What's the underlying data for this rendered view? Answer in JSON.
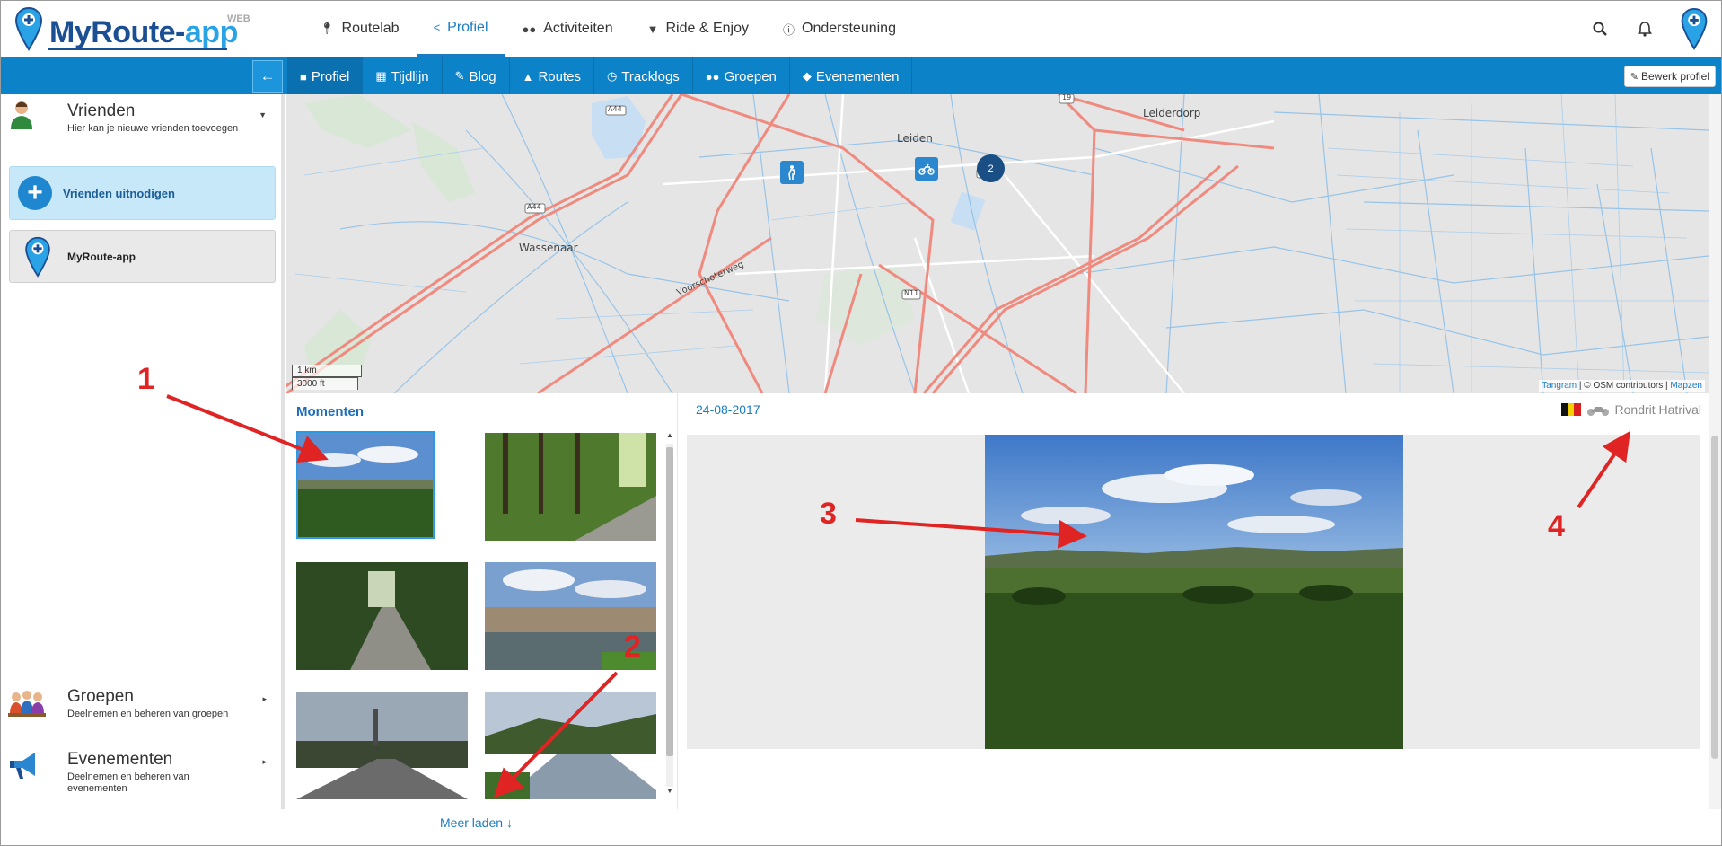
{
  "header": {
    "logo_prefix": "MyRoute-",
    "logo_suffix": "app",
    "logo_tag": "WEB",
    "nav": [
      {
        "label": "Routelab",
        "icon": "map-marker-icon"
      },
      {
        "label": "Profiel",
        "icon": "share-icon",
        "active": true
      },
      {
        "label": "Activiteiten",
        "icon": "users-icon"
      },
      {
        "label": "Ride & Enjoy",
        "icon": "trophy-icon"
      },
      {
        "label": "Ondersteuning",
        "icon": "info-icon"
      }
    ]
  },
  "subnav": {
    "tabs": [
      {
        "label": "Profiel",
        "icon": "user-icon",
        "active": true
      },
      {
        "label": "Tijdlijn",
        "icon": "calendar-icon"
      },
      {
        "label": "Blog",
        "icon": "pencil-icon"
      },
      {
        "label": "Routes",
        "icon": "road-icon"
      },
      {
        "label": "Tracklogs",
        "icon": "clock-icon"
      },
      {
        "label": "Groepen",
        "icon": "users-icon"
      },
      {
        "label": "Evenementen",
        "icon": "ticket-icon"
      }
    ],
    "edit_label": "Bewerk profiel"
  },
  "sidebar": {
    "friends": {
      "title": "Vrienden",
      "subtitle": "Hier kan je nieuwe vrienden toevoegen",
      "invite_label": "Vrienden uitnodigen",
      "contact_name": "MyRoute-app"
    },
    "groups": {
      "title": "Groepen",
      "subtitle": "Deelnemen en beheren van groepen"
    },
    "events": {
      "title": "Evenementen",
      "subtitle": "Deelnemen en beheren van evenementen"
    }
  },
  "map": {
    "labels": {
      "leiden": "Leiden",
      "leiderdorp": "Leiderdorp",
      "wassenaar": "Wassenaar",
      "voorschoterweg": "Voorschoterweg",
      "a44_top": "A44",
      "a44_mid": "A44",
      "n19_top": "19",
      "n19_mid": "19",
      "n11": "N11"
    },
    "cluster_count": "2",
    "scale_km": "1 km",
    "scale_ft": "3000 ft",
    "attribution": {
      "tangram": "Tangram",
      "osm": "© OSM contributors",
      "mapzen": "Mapzen",
      "sep": "|"
    }
  },
  "momenten": {
    "title": "Momenten",
    "load_more": "Meer laden"
  },
  "detail": {
    "date": "24-08-2017",
    "route_name": "Rondrit Hatrival",
    "flag_colors": [
      "#111111",
      "#f5d000",
      "#d91e1e"
    ]
  },
  "annotations": [
    "1",
    "2",
    "3",
    "4"
  ],
  "colors": {
    "primary": "#0c82c8",
    "accent_link": "#1a7dc4",
    "annotation": "#e02424"
  }
}
